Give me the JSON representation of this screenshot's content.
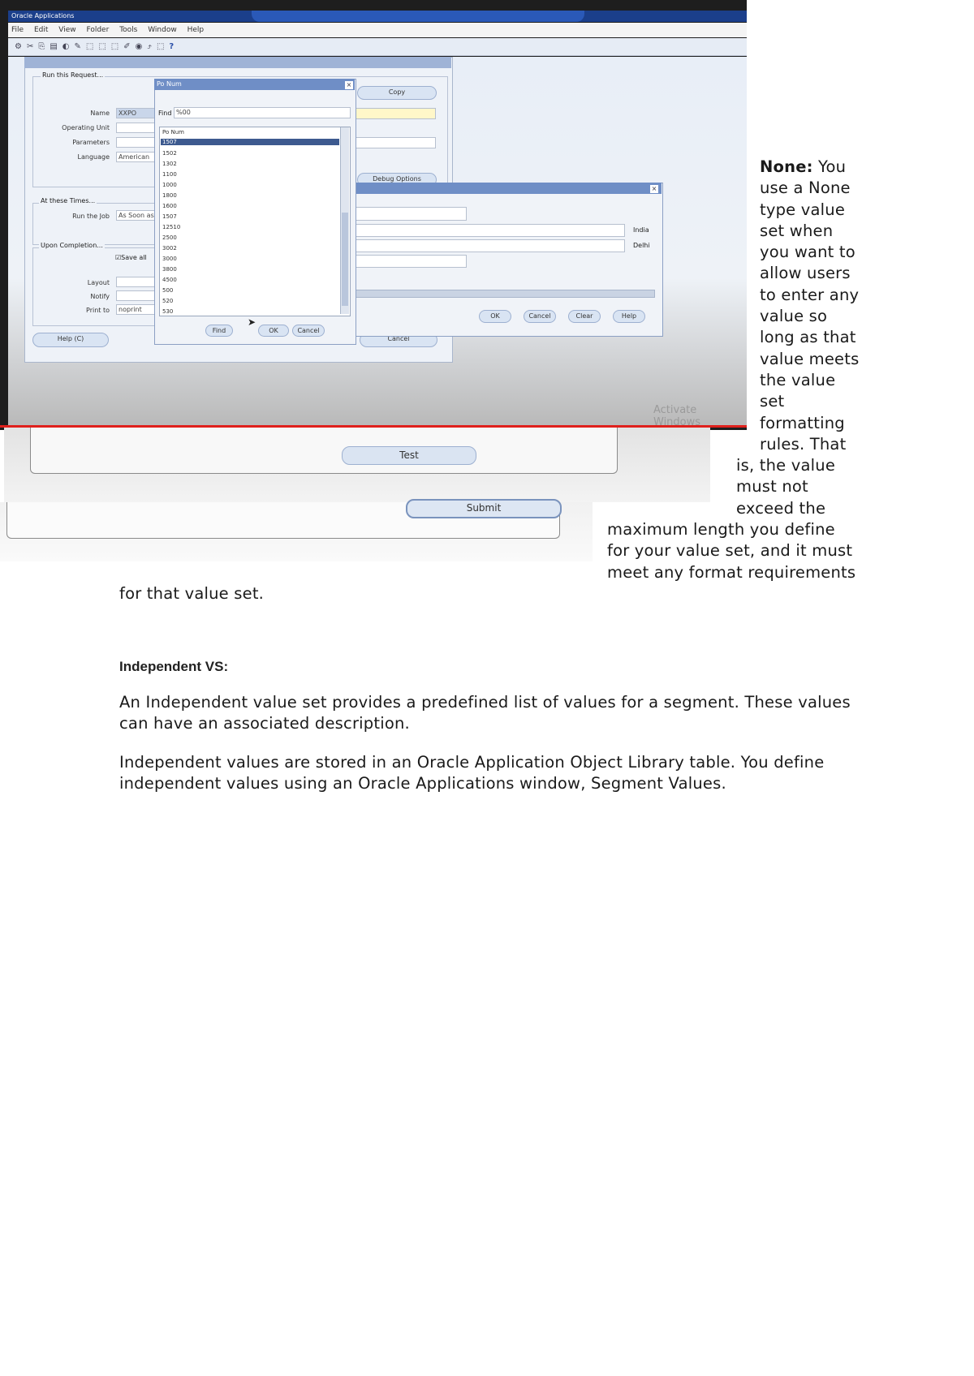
{
  "screenshot": {
    "app_title": "Oracle Applications",
    "menu": [
      "File",
      "Edit",
      "View",
      "Folder",
      "Tools",
      "Window",
      "Help"
    ],
    "request_window": {
      "section_run": "Run this Request...",
      "labels": {
        "name": "Name",
        "operating_unit": "Operating Unit",
        "parameters": "Parameters",
        "language": "Language"
      },
      "name_value": "XXPO",
      "language_value": "American",
      "copy_button": "Copy",
      "section_times": "At these Times...",
      "run_job_label": "Run the Job",
      "run_job_value": "As Soon as",
      "debug_button": "Debug Options",
      "section_completion": "Upon Completion...",
      "save_checkbox": "Save all",
      "layout_label": "Layout",
      "notify_label": "Notify",
      "print_label": "Print to",
      "print_value": "noprint",
      "help_button": "Help (C)",
      "cancel_button": "Cancel"
    },
    "lov_dialog": {
      "title": "Po Num",
      "find_label": "Find",
      "find_value": "%00",
      "column_header": "Po Num",
      "items": [
        "1507",
        "1502",
        "1302",
        "1100",
        "1000",
        "1800",
        "1600",
        "1507",
        "12510",
        "2500",
        "3002",
        "3000",
        "3800",
        "4500",
        "500",
        "520",
        "530"
      ],
      "selected_index": 0,
      "find_button": "Find",
      "ok_button": "OK",
      "cancel_button": "Cancel"
    },
    "param_dialog": {
      "side_labels": [
        "India",
        "Delhi"
      ],
      "ok_button": "OK",
      "cancel_button": "Cancel",
      "clear_button": "Clear",
      "help_button": "Help"
    },
    "watermark": "Activate Windows",
    "test_button": "Test",
    "submit_button": "Submit"
  },
  "document": {
    "none_heading": "None:",
    "none_wrapped_lines": [
      "None: You",
      "use a None",
      "type value",
      "set when",
      "you want to",
      "allow users",
      "to enter any",
      "value so",
      "long as that",
      "value meets",
      "the value",
      "set",
      "formatting",
      "rules. That"
    ],
    "mid_lines": [
      "is, the value",
      "must not",
      "exceed the"
    ],
    "wide_lines": [
      "maximum length you define",
      "for your value set, and it must",
      "meet any format requirements"
    ],
    "last_line": "for that value set.",
    "independent_heading": "Independent VS:",
    "para1": "An Independent value set provides a predefined list of values for a segment. These values can have an associated description.",
    "para2": "Independent values are stored in an Oracle Application Object Library table. You define independent values using an Oracle Applications window, Segment Values."
  }
}
